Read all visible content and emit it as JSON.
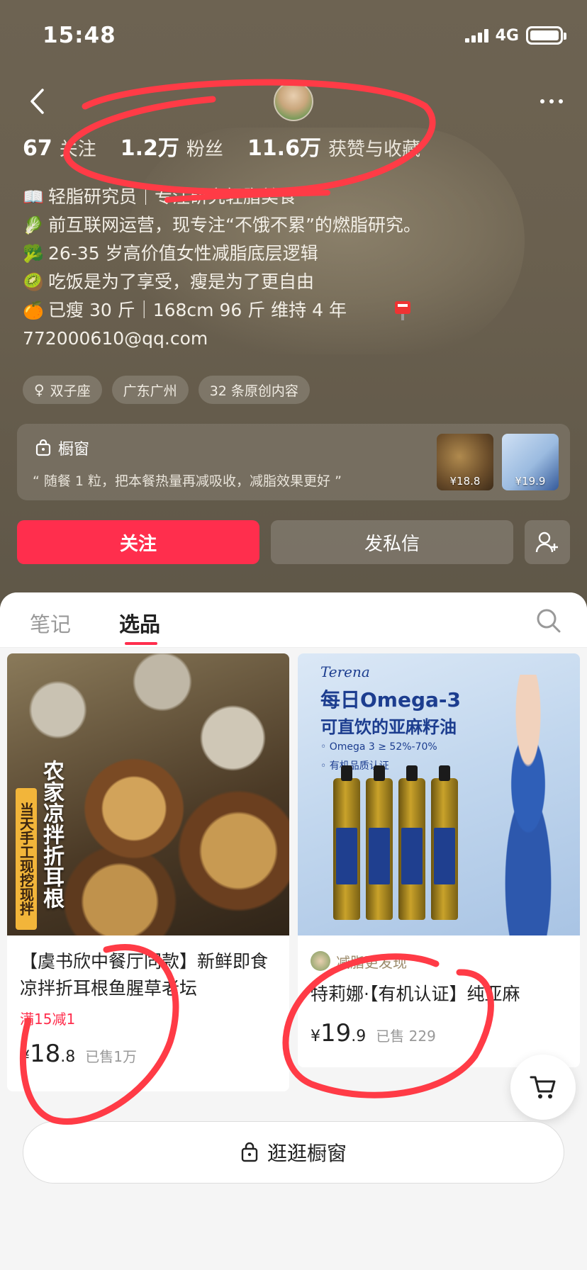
{
  "status_bar": {
    "time": "15:48",
    "network": "4G"
  },
  "stats": [
    {
      "num": "67",
      "label": "关注"
    },
    {
      "num": "1.2万",
      "label": "粉丝"
    },
    {
      "num": "11.6万",
      "label": "获赞与收藏"
    }
  ],
  "bio": [
    {
      "icon": "book-icon",
      "glyph": "📖",
      "text": "轻脂研究员｜专注研究轻脂美食"
    },
    {
      "icon": "leaf-icon",
      "glyph": "🥬",
      "text": "前互联网运营，现专注“不饿不累”的燃脂研究。"
    },
    {
      "icon": "broccoli-icon",
      "glyph": "🥦",
      "text": "26-35 岁高价值女性减脂底层逻辑"
    },
    {
      "icon": "kiwi-icon",
      "glyph": "🥝",
      "text": "吃饭是为了享受，瘦是为了更自由"
    },
    {
      "icon": "orange-icon",
      "glyph": "🍊",
      "text": "已瘦 30 斤｜168cm 96 斤 维持 4 年"
    },
    {
      "icon": "",
      "glyph": "",
      "text": "772000610@qq.com"
    }
  ],
  "tags": [
    {
      "symbol": "♀",
      "text": "双子座"
    },
    {
      "symbol": "",
      "text": "广东广州"
    },
    {
      "symbol": "",
      "text": "32 条原创内容"
    }
  ],
  "shop": {
    "title": "橱窗",
    "quote": "“ 随餐 1 粒，把本餐热量再减吸收，减脂效果更好 ”",
    "thumbs": [
      {
        "price": "¥18.8"
      },
      {
        "price": "¥19.9"
      }
    ]
  },
  "buttons": {
    "follow": "关注",
    "message": "发私信"
  },
  "tabs": {
    "notes": "笔记",
    "picks": "选品"
  },
  "products": [
    {
      "image_text_main": "农家凉拌折耳根",
      "image_text_sub": "当天手工现挖现拌",
      "title": "【虞书欣中餐厅同款】新鲜即食凉拌折耳根鱼腥草老坛",
      "promo": "满15减1",
      "price_symbol": "¥",
      "price_int": "18",
      "price_dec": ".8",
      "sold": "已售1万"
    },
    {
      "brand": "Terena",
      "image_h1": "每日Omega-3",
      "image_h2": "可直饮的亚麻籽油",
      "image_b1": "◦ Omega 3 ≥ 52%-70%",
      "image_b2": "◦ 有机品质认证",
      "seller": "减脂更发现",
      "title": "特莉娜·【有机认证】纯亚麻",
      "price_symbol": "¥",
      "price_int": "19",
      "price_dec": ".9",
      "sold": "已售 229"
    }
  ],
  "browse_button": "逛逛橱窗",
  "colors": {
    "accent": "#ff2e4d",
    "annotation": "#ff3b46",
    "header_bg": "#6a604f"
  }
}
